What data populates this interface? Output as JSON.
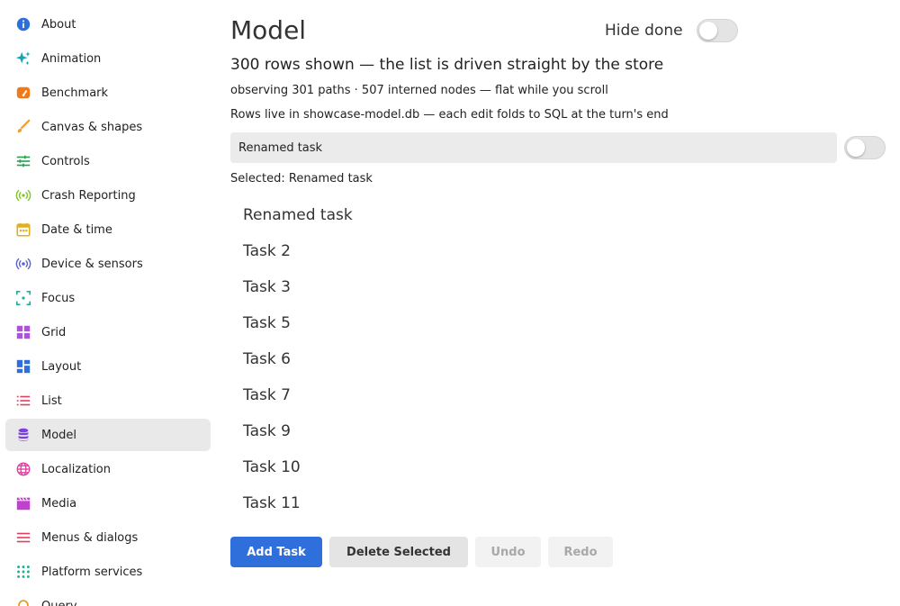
{
  "sidebar": {
    "items": [
      {
        "label": "About",
        "icon": "info-icon",
        "color": "#2f6fdb"
      },
      {
        "label": "Animation",
        "icon": "sparkles-icon",
        "color": "#17a2b8"
      },
      {
        "label": "Benchmark",
        "icon": "speedometer-icon",
        "color": "#f07a1a"
      },
      {
        "label": "Canvas & shapes",
        "icon": "brush-icon",
        "color": "#f0a030"
      },
      {
        "label": "Controls",
        "icon": "sliders-icon",
        "color": "#28a050"
      },
      {
        "label": "Crash Reporting",
        "icon": "broadcast-icon",
        "color": "#7cc820"
      },
      {
        "label": "Date & time",
        "icon": "calendar-icon",
        "color": "#e0b020"
      },
      {
        "label": "Device & sensors",
        "icon": "sensor-icon",
        "color": "#5a64d0"
      },
      {
        "label": "Focus",
        "icon": "focus-icon",
        "color": "#20b0a0"
      },
      {
        "label": "Grid",
        "icon": "grid-icon",
        "color": "#b050e0"
      },
      {
        "label": "Layout",
        "icon": "dashboard-icon",
        "color": "#2f6fdb"
      },
      {
        "label": "List",
        "icon": "list-icon",
        "color": "#e04060"
      },
      {
        "label": "Model",
        "icon": "database-icon",
        "color": "#7a40e0"
      },
      {
        "label": "Localization",
        "icon": "globe-icon",
        "color": "#e040a0"
      },
      {
        "label": "Media",
        "icon": "clapperboard-icon",
        "color": "#c040d0"
      },
      {
        "label": "Menus & dialogs",
        "icon": "menu-icon",
        "color": "#e04060"
      },
      {
        "label": "Platform services",
        "icon": "apps-grid-icon",
        "color": "#20b090"
      },
      {
        "label": "Query",
        "icon": "query-icon",
        "color": "#e0a020"
      }
    ],
    "selected": "Model"
  },
  "main": {
    "title": "Model",
    "hide_done_label": "Hide done",
    "headline": "300 rows shown — the list is driven straight by the store",
    "stats": "observing 301 paths · 507 interned nodes — flat while you scroll",
    "db_note": "Rows live in showcase-model.db — each edit folds to SQL at the turn's end",
    "name_input_value": "Renamed task",
    "selected_text": "Selected: Renamed task",
    "tasks": [
      "Renamed task",
      "Task 2",
      "Task 3",
      "Task 5",
      "Task 6",
      "Task 7",
      "Task 9",
      "Task 10",
      "Task 11"
    ],
    "buttons": {
      "add_task": "Add Task",
      "delete_selected": "Delete Selected",
      "undo": "Undo",
      "redo": "Redo"
    }
  },
  "colors": {
    "accent": "#2f6fdb",
    "selected_background": "#e9e9e9"
  }
}
